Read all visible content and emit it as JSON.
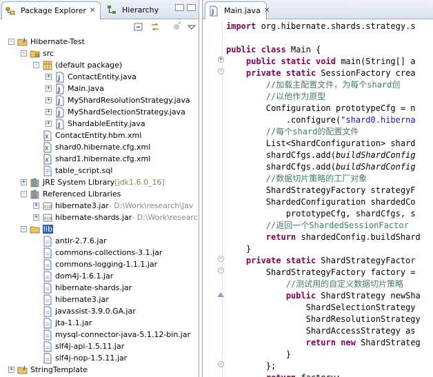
{
  "left_view": {
    "tabs": [
      {
        "label": "Package Explorer",
        "icon": "package-explorer-icon",
        "close": "✕"
      },
      {
        "label": "Hierarchy",
        "icon": "hierarchy-icon"
      }
    ],
    "tree": [
      {
        "label": "Hibernate-Test",
        "icon": "project-icon",
        "level": 0,
        "toggle": "-"
      },
      {
        "label": "src",
        "icon": "source-folder-icon",
        "level": 1,
        "toggle": "-"
      },
      {
        "label": "(default package)",
        "icon": "package-icon",
        "level": 2,
        "toggle": "-"
      },
      {
        "label": "ContactEntity.java",
        "icon": "java-file-icon",
        "level": 3,
        "toggle": "+"
      },
      {
        "label": "Main.java",
        "icon": "java-file-icon",
        "level": 3,
        "toggle": "+"
      },
      {
        "label": "MyShardResolutionStrategy.java",
        "icon": "java-file-icon",
        "level": 3,
        "toggle": "+"
      },
      {
        "label": "MyShardSelectionStrategy.java",
        "icon": "java-file-icon",
        "level": 3,
        "toggle": "+"
      },
      {
        "label": "ShardableEntity.java",
        "icon": "java-file-icon",
        "level": 3,
        "toggle": "+"
      },
      {
        "label": "ContactEntity.hbm.xml",
        "icon": "xml-file-icon",
        "level": 2,
        "toggle": ""
      },
      {
        "label": "shard0.hibernate.cfg.xml",
        "icon": "xml-file-icon",
        "level": 2,
        "toggle": ""
      },
      {
        "label": "shard1.hibernate.cfg.xml",
        "icon": "xml-file-icon",
        "level": 2,
        "toggle": ""
      },
      {
        "label": "table_script.sql",
        "icon": "sql-file-icon",
        "level": 2,
        "toggle": ""
      },
      {
        "label": "JRE System Library",
        "decor": "[jdk1.6.0_16]",
        "decor_style": "green",
        "icon": "library-icon",
        "level": 1,
        "toggle": "+"
      },
      {
        "label": "Referenced Libraries",
        "icon": "library-icon",
        "level": 1,
        "toggle": "-"
      },
      {
        "label": "hibernate3.jar",
        "decor": "- D:\\Work\\research\\Jav",
        "icon": "jar-icon",
        "level": 2,
        "toggle": "+"
      },
      {
        "label": "hibernate-shards.jar",
        "decor": "- D:\\Work\\researc",
        "icon": "jar-icon",
        "level": 2,
        "toggle": "+"
      },
      {
        "label": "lib",
        "icon": "folder-icon",
        "level": 1,
        "toggle": "-",
        "selected": true
      },
      {
        "label": "antlr-2.7.6.jar",
        "icon": "jar-file-icon",
        "level": 2,
        "toggle": ""
      },
      {
        "label": "commons-collections-3.1.jar",
        "icon": "jar-file-icon",
        "level": 2,
        "toggle": ""
      },
      {
        "label": "commons-logging-1.1.1.jar",
        "icon": "jar-file-icon",
        "level": 2,
        "toggle": ""
      },
      {
        "label": "dom4j-1.6.1.jar",
        "icon": "jar-file-icon",
        "level": 2,
        "toggle": ""
      },
      {
        "label": "hibernate-shards.jar",
        "icon": "jar-file-icon",
        "level": 2,
        "toggle": ""
      },
      {
        "label": "hibernate3.jar",
        "icon": "jar-file-icon",
        "level": 2,
        "toggle": ""
      },
      {
        "label": "javassist-3.9.0.GA.jar",
        "icon": "jar-file-icon",
        "level": 2,
        "toggle": ""
      },
      {
        "label": "jta-1.1.jar",
        "icon": "jar-file-icon",
        "level": 2,
        "toggle": ""
      },
      {
        "label": "mysql-connector-java-5.1.12-bin.jar",
        "icon": "jar-file-icon",
        "level": 2,
        "toggle": ""
      },
      {
        "label": "slf4j-api-1.5.11.jar",
        "icon": "jar-file-icon",
        "level": 2,
        "toggle": ""
      },
      {
        "label": "slf4j-nop-1.5.11.jar",
        "icon": "jar-file-icon",
        "level": 2,
        "toggle": ""
      },
      {
        "label": "StringTemplate",
        "icon": "project-icon",
        "level": 0,
        "toggle": "+"
      }
    ]
  },
  "editor": {
    "tab": {
      "label": "Main.java",
      "icon": "java-file-icon",
      "close": "✕"
    },
    "lines": [
      [
        [
          "kw",
          "import"
        ],
        [
          "",
          "org.hibernate.shards.strategy.s"
        ]
      ],
      [],
      [
        [
          "kw",
          "public class"
        ],
        [
          "",
          "Main {"
        ]
      ],
      [
        [
          "",
          "    "
        ],
        [
          "kw",
          "public static void"
        ],
        [
          "",
          "main(String[] a"
        ]
      ],
      [
        [
          "",
          "    "
        ],
        [
          "kw",
          "private static"
        ],
        [
          "",
          "SessionFactory crea"
        ]
      ],
      [
        [
          "",
          "        "
        ],
        [
          "cm",
          "//加载主配置文件，为每个shard创"
        ]
      ],
      [
        [
          "",
          "        "
        ],
        [
          "cm",
          "//以他作为原型"
        ]
      ],
      [
        [
          "",
          "        Configuration prototypeCfg = n"
        ]
      ],
      [
        [
          "",
          "            .configure("
        ],
        [
          "str",
          "\"shard0.hiberna"
        ]
      ],
      [
        [
          "",
          "        "
        ],
        [
          "cm",
          "//每个shard的配置文件"
        ]
      ],
      [
        [
          "",
          "        List<ShardConfiguration> shard"
        ]
      ],
      [
        [
          "",
          "        shardCfgs.add("
        ],
        [
          "it",
          "buildShardConfig"
        ]
      ],
      [
        [
          "",
          "        shardCfgs.add("
        ],
        [
          "it",
          "buildShardConfig"
        ]
      ],
      [
        [
          "",
          "        "
        ],
        [
          "cm",
          "//数据切片策略的工厂对象"
        ]
      ],
      [
        [
          "",
          "        ShardStrategyFactory strategyF"
        ]
      ],
      [
        [
          "",
          "        ShardedConfiguration shardedCo"
        ]
      ],
      [
        [
          "",
          "            prototypeCfg, shardCfgs, s"
        ]
      ],
      [
        [
          "",
          "        "
        ],
        [
          "cm",
          "//返回一个ShardedSessionFactor"
        ]
      ],
      [
        [
          "",
          "        "
        ],
        [
          "kw",
          "return"
        ],
        [
          "",
          "shardedConfig.buildShard"
        ]
      ],
      [
        [
          "",
          "    }"
        ]
      ],
      [
        [
          "",
          "    "
        ],
        [
          "kw",
          "private static"
        ],
        [
          "",
          "ShardStrategyFactor"
        ]
      ],
      [
        [
          "",
          "        ShardStrategyFactory factory = "
        ]
      ],
      [
        [
          "",
          "            "
        ],
        [
          "cm",
          "//测试用的自定义数据切片策略"
        ]
      ],
      [
        [
          "",
          "            "
        ],
        [
          "kw",
          "public"
        ],
        [
          "",
          "ShardStrategy newSha"
        ]
      ],
      [
        [
          "",
          "                ShardSelectionStrategy "
        ]
      ],
      [
        [
          "",
          "                ShardResolutionStrategy"
        ]
      ],
      [
        [
          "",
          "                ShardAccessStrategy as "
        ]
      ],
      [
        [
          "",
          "                "
        ],
        [
          "kw",
          "return new"
        ],
        [
          "",
          "ShardStrateg"
        ]
      ],
      [
        [
          "",
          "            }"
        ]
      ],
      [
        [
          "",
          "        };"
        ]
      ],
      [
        [
          "",
          "        "
        ],
        [
          "kw",
          "return"
        ],
        [
          "",
          "factory;"
        ]
      ]
    ]
  }
}
